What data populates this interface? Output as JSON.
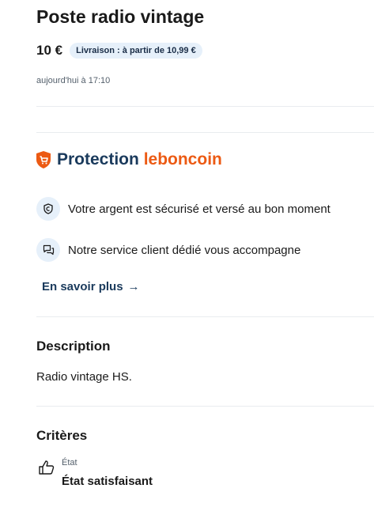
{
  "listing": {
    "title": "Poste radio vintage",
    "price": "10 €",
    "delivery_badge": "Livraison : à partir de 10,99 €",
    "posted_at": "aujourd'hui à 17:10"
  },
  "protection": {
    "title_word": "Protection",
    "brand": "leboncoin",
    "features": [
      {
        "icon": "shield-check-icon",
        "text": "Votre argent est sécurisé et versé au bon moment"
      },
      {
        "icon": "chat-bubbles-icon",
        "text": "Notre service client dédié vous accompagne"
      }
    ],
    "learn_more": "En savoir plus",
    "learn_more_arrow": "→"
  },
  "description": {
    "heading": "Description",
    "text": "Radio vintage HS."
  },
  "criteria": {
    "heading": "Critères",
    "items": [
      {
        "icon": "thumbs-up-icon",
        "label": "État",
        "value": "État satisfaisant"
      }
    ]
  },
  "colors": {
    "brand_orange": "#ec5a13",
    "navy": "#1a3a5c",
    "badge_bg": "#e6f0fa"
  }
}
